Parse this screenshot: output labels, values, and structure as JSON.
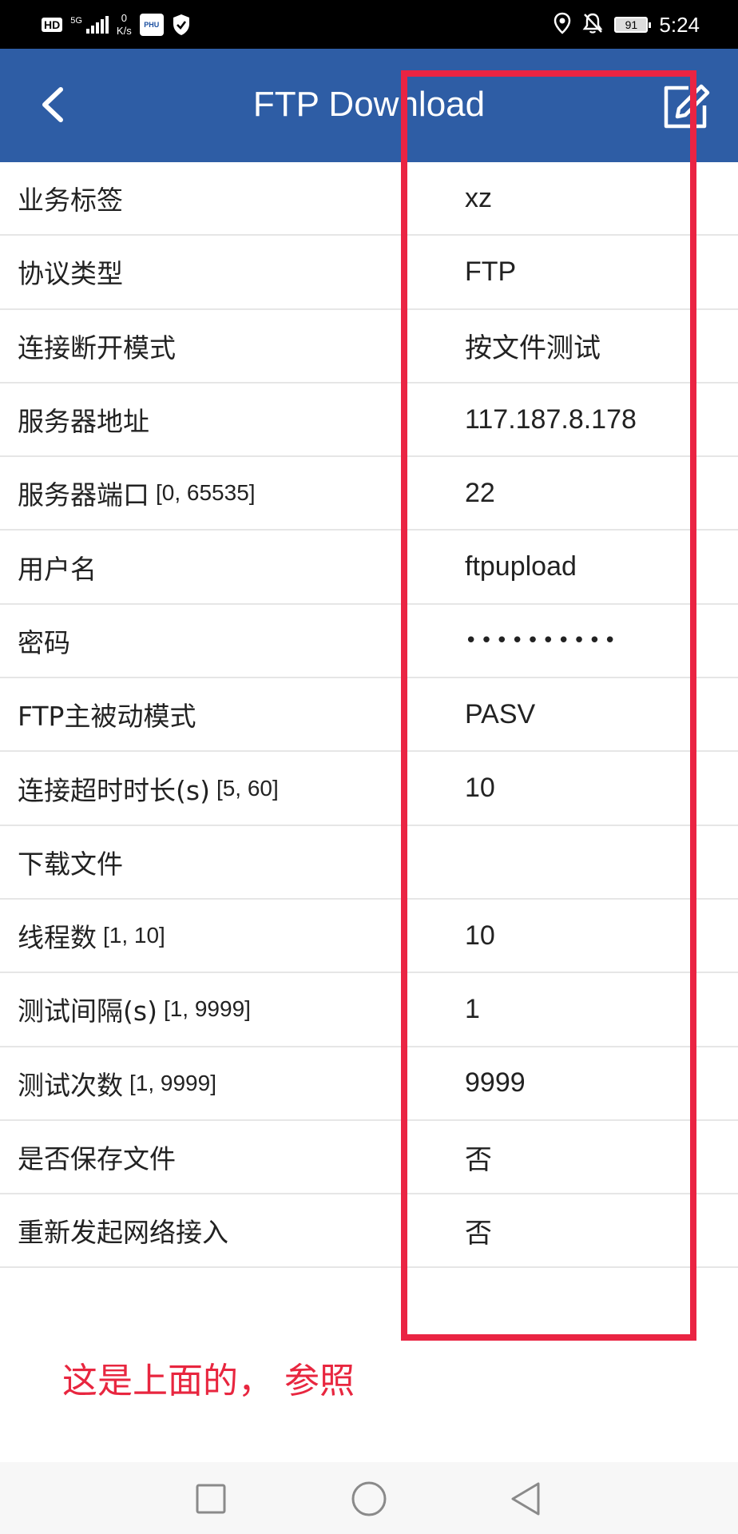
{
  "status_bar": {
    "hd": "HD",
    "network": "5G",
    "speed_value": "0",
    "speed_unit": "K/s",
    "app_badge": "PHU",
    "battery": "91",
    "time": "5:24"
  },
  "header": {
    "title": "FTP Download",
    "color": "#2e5da5"
  },
  "rows": [
    {
      "label": "业务标签",
      "range": "",
      "value": "xz"
    },
    {
      "label": "协议类型",
      "range": "",
      "value": "FTP"
    },
    {
      "label": "连接断开模式",
      "range": "",
      "value": "按文件测试"
    },
    {
      "label": "服务器地址",
      "range": "",
      "value": "117.187.8.178"
    },
    {
      "label": "服务器端口",
      "range": "[0, 65535]",
      "value": "22"
    },
    {
      "label": "用户名",
      "range": "",
      "value": "ftpupload"
    },
    {
      "label": "密码",
      "range": "",
      "value": "••••••••••"
    },
    {
      "label": "FTP主被动模式",
      "range": "",
      "value": "PASV"
    },
    {
      "label": "连接超时时长(s)",
      "range": "[5, 60]",
      "value": "10"
    },
    {
      "label": "下载文件",
      "range": "",
      "value": ""
    },
    {
      "label": "线程数",
      "range": "[1, 10]",
      "value": "10"
    },
    {
      "label": "测试间隔(s)",
      "range": "[1, 9999]",
      "value": "1"
    },
    {
      "label": "测试次数",
      "range": "[1, 9999]",
      "value": "9999"
    },
    {
      "label": "是否保存文件",
      "range": "",
      "value": "否"
    },
    {
      "label": "重新发起网络接入",
      "range": "",
      "value": "否"
    }
  ],
  "annotation": {
    "note": "这是上面的， 参照",
    "color": "#ea2443"
  },
  "nav_bar": {
    "icons": [
      "recent-apps-icon",
      "home-icon",
      "back-icon"
    ]
  }
}
